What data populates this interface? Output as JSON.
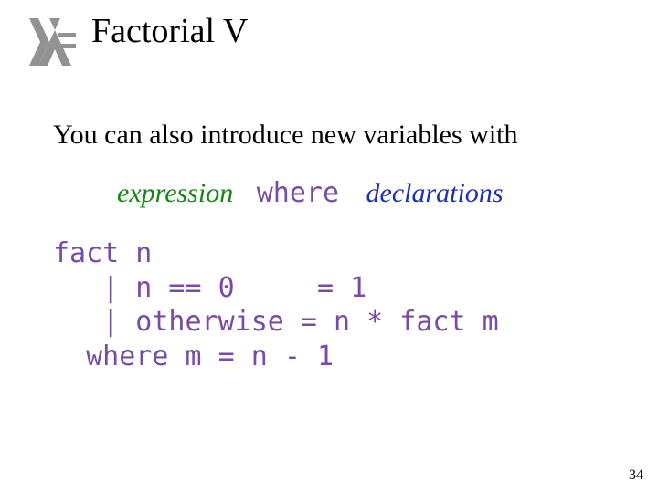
{
  "title": "Factorial V",
  "intro": "You can also introduce new variables with",
  "syntax": {
    "expression": "expression",
    "where_kw": "where",
    "declarations": "declarations"
  },
  "code": "fact n\n   | n == 0     = 1\n   | otherwise = n * fact m\n  where m = n - 1",
  "page_number": "34",
  "colors": {
    "code_purple": "#7a4aa8",
    "expr_green": "#0d8a0d",
    "decl_blue": "#1c2fb8",
    "logo_dark": "#3a3a3a"
  }
}
